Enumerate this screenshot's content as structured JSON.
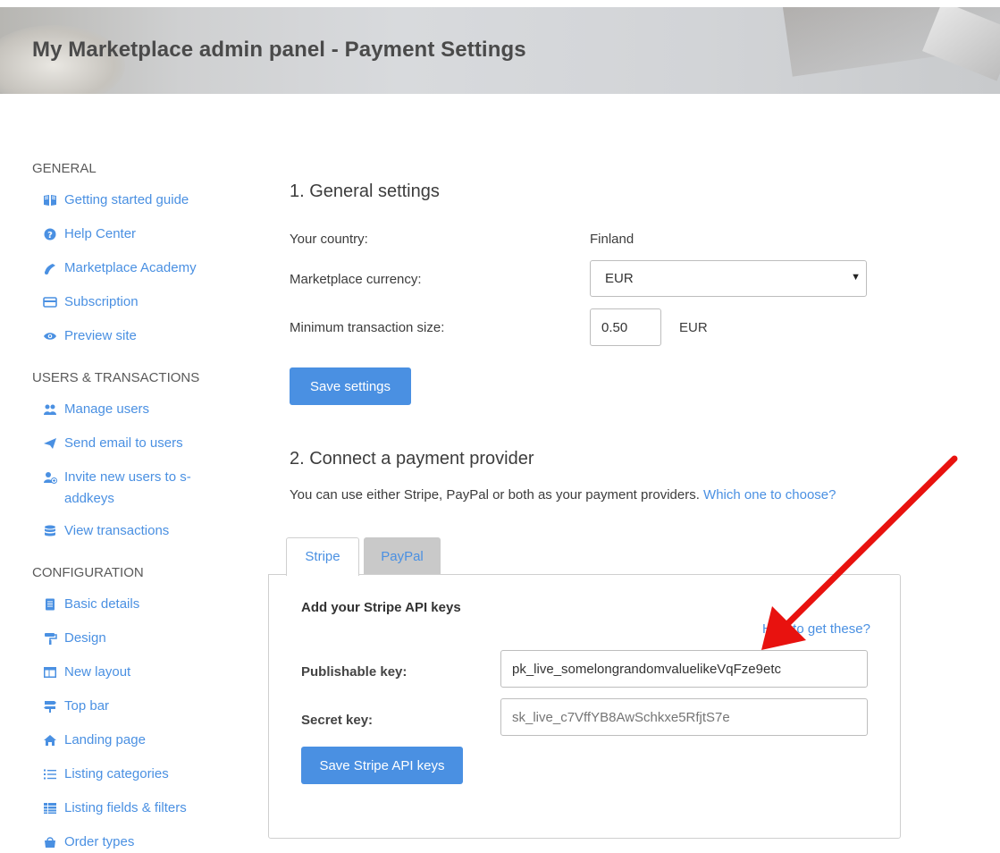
{
  "header": {
    "title": "My Marketplace admin panel - Payment Settings"
  },
  "sidebar": {
    "sections": [
      {
        "title": "GENERAL",
        "items": [
          {
            "label": "Getting started guide",
            "icon": "book-icon"
          },
          {
            "label": "Help Center",
            "icon": "question-circle-icon"
          },
          {
            "label": "Marketplace Academy",
            "icon": "graduation-icon"
          },
          {
            "label": "Subscription",
            "icon": "credit-card-icon"
          },
          {
            "label": "Preview site",
            "icon": "eye-icon"
          }
        ]
      },
      {
        "title": "USERS & TRANSACTIONS",
        "items": [
          {
            "label": "Manage users",
            "icon": "users-icon"
          },
          {
            "label": "Send email to users",
            "icon": "paper-plane-icon"
          },
          {
            "label": "Invite new users to s-addkeys",
            "icon": "user-plus-icon"
          },
          {
            "label": "View transactions",
            "icon": "database-icon"
          }
        ]
      },
      {
        "title": "CONFIGURATION",
        "items": [
          {
            "label": "Basic details",
            "icon": "document-icon"
          },
          {
            "label": "Design",
            "icon": "paint-roller-icon"
          },
          {
            "label": "New layout",
            "icon": "layout-icon"
          },
          {
            "label": "Top bar",
            "icon": "signpost-icon"
          },
          {
            "label": "Landing page",
            "icon": "home-icon"
          },
          {
            "label": "Listing categories",
            "icon": "list-icon"
          },
          {
            "label": "Listing fields & filters",
            "icon": "table-icon"
          },
          {
            "label": "Order types",
            "icon": "bag-icon"
          }
        ]
      }
    ]
  },
  "general": {
    "heading": "1. General settings",
    "country_label": "Your country:",
    "country_value": "Finland",
    "currency_label": "Marketplace currency:",
    "currency_value": "EUR",
    "min_label": "Minimum transaction size:",
    "min_value": "0.50",
    "min_unit": "EUR",
    "save_label": "Save settings"
  },
  "provider": {
    "heading": "2. Connect a payment provider",
    "description": "You can use either Stripe, PayPal or both as your payment providers.",
    "choose_link": "Which one to choose?",
    "tabs": [
      {
        "label": "Stripe",
        "active": true
      },
      {
        "label": "PayPal",
        "active": false
      }
    ],
    "stripe": {
      "panel_title": "Add your Stripe API keys",
      "help_link": "How to get these?",
      "publishable_label": "Publishable key:",
      "publishable_value": "pk_live_somelongrandomvaluelikeVqFze9etc",
      "secret_label": "Secret key:",
      "secret_placeholder": "sk_live_c7VffYB8AwSchkxe5RfjtS7e",
      "save_label": "Save Stripe API keys"
    }
  },
  "colors": {
    "accent": "#4a90e2",
    "annotation_arrow": "#e8120f",
    "tab_inactive_bg": "#c9c9c9"
  }
}
